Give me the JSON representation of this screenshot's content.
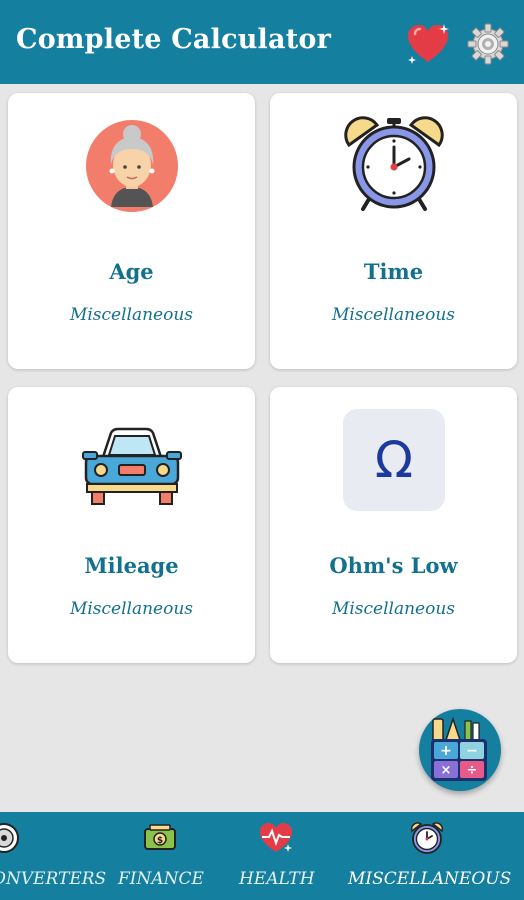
{
  "app": {
    "title": "Complete Calculator"
  },
  "header": {
    "favorites_icon": "heart-sparkle-icon",
    "settings_icon": "gear-icon"
  },
  "cards": [
    {
      "name": "Age",
      "category": "Miscellaneous",
      "icon": "grandma-avatar-icon"
    },
    {
      "name": "Time",
      "category": "Miscellaneous",
      "icon": "alarm-clock-icon"
    },
    {
      "name": "Mileage",
      "category": "Miscellaneous",
      "icon": "car-icon"
    },
    {
      "name": "Ohm's Low",
      "category": "Miscellaneous",
      "icon": "omega-icon"
    }
  ],
  "fab": {
    "icon": "calculator-tools-icon"
  },
  "bottom_nav": [
    {
      "label": "CONVERTERS",
      "icon": "converter-icon",
      "active": false
    },
    {
      "label": "FINANCE",
      "icon": "money-icon",
      "active": false
    },
    {
      "label": "HEALTH",
      "icon": "heart-icon",
      "active": false
    },
    {
      "label": "MISCELLANEOUS",
      "icon": "alarm-clock-icon",
      "active": true
    }
  ],
  "colors": {
    "primary": "#157fa0",
    "text_accent": "#13718f",
    "background": "#e6e6e6",
    "card": "#ffffff"
  }
}
